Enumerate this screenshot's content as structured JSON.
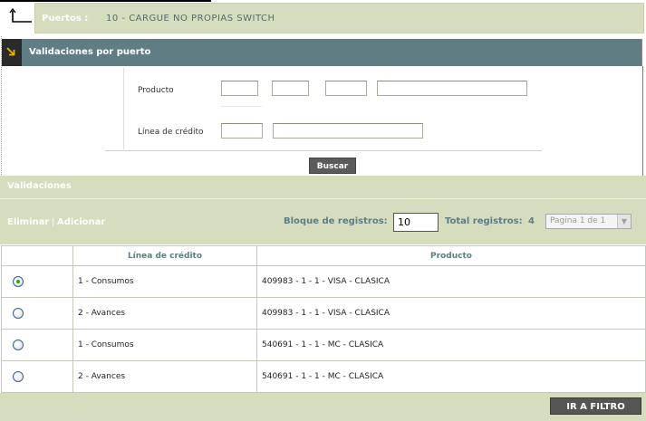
{
  "breadcrumb": {
    "label": "Puertos :",
    "value": "10 -   CARGUE NO PROPIAS SWITCH"
  },
  "section": {
    "title": "Validaciones por puerto"
  },
  "form": {
    "producto_label": "Producto",
    "linea_label": "Línea de crédito",
    "producto_values": [
      "",
      "",
      "",
      ""
    ],
    "linea_values": [
      "",
      ""
    ],
    "buscar_label": "Buscar"
  },
  "validaciones": {
    "title": "Validaciones",
    "eliminar": "Eliminar",
    "separator": "|",
    "adicionar": "Adicionar",
    "bloque_label": "Bloque de registros:",
    "bloque_value": "10",
    "total_label": "Total registros:",
    "total_value": "4",
    "page_select": "Pagina 1 de 1"
  },
  "table": {
    "headers": [
      "",
      "Línea de crédito",
      "Producto"
    ],
    "rows": [
      {
        "selected": true,
        "linea": "1 - Consumos",
        "producto": "409983 - 1 - 1 - VISA - CLASICA"
      },
      {
        "selected": false,
        "linea": "2 - Avances",
        "producto": "409983 - 1 - 1 - VISA - CLASICA"
      },
      {
        "selected": false,
        "linea": "1 - Consumos",
        "producto": "540691 - 1 - 1 - MC - CLASICA"
      },
      {
        "selected": false,
        "linea": "2 - Avances",
        "producto": "540691 - 1 - 1 - MC - CLASICA"
      }
    ]
  },
  "footer": {
    "ir_filtro": "IR A FILTRO"
  },
  "icons": {
    "corner": "return-arrow-icon",
    "section": "arrow-down-right-icon",
    "select": "chevron-down-icon"
  },
  "colors": {
    "band": "#d6dcbe",
    "header": "#5f7d82",
    "button": "#555555"
  }
}
